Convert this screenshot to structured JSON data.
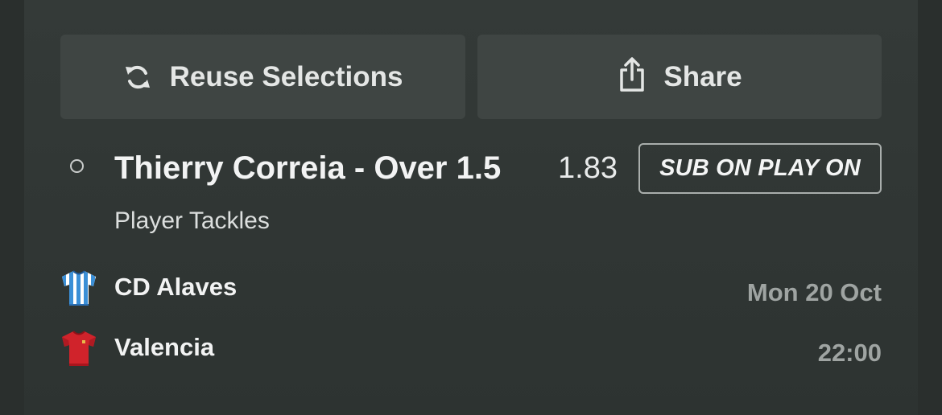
{
  "actions": {
    "reuse_label": "Reuse Selections",
    "reuse_icon": "refresh-icon",
    "share_label": "Share",
    "share_icon": "share-icon"
  },
  "selection": {
    "title": "Thierry Correia - Over 1.5",
    "odds": "1.83",
    "badge": "SUB ON PLAY ON",
    "market": "Player Tackles"
  },
  "match": {
    "home_team": "CD Alaves",
    "away_team": "Valencia",
    "date": "Mon 20 Oct",
    "time": "22:00"
  },
  "colors": {
    "background": "#303634",
    "button_bg": "#3f4543",
    "text_primary": "#f2f3f3",
    "text_muted": "#9fa4a2",
    "home_shirt": "#3b8fd6",
    "away_shirt": "#d0232b"
  }
}
